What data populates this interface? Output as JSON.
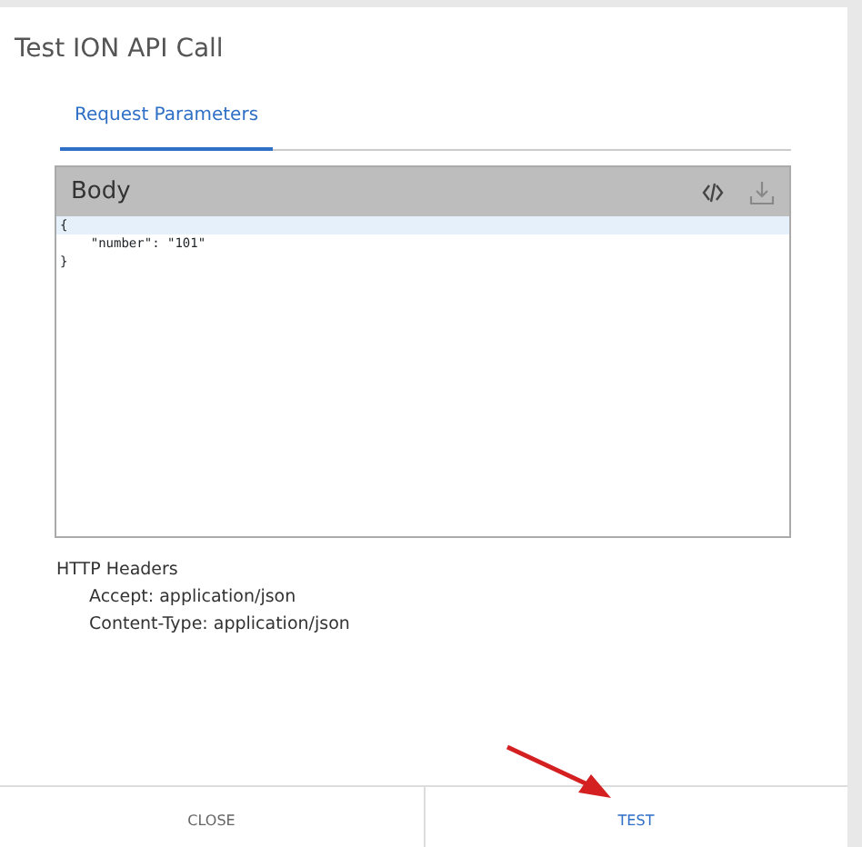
{
  "dialog": {
    "title": "Test ION API Call"
  },
  "tabs": [
    {
      "label": "Request Parameters",
      "selected": true
    }
  ],
  "body_panel": {
    "title": "Body",
    "lines": [
      {
        "text": "{",
        "highlighted": true
      },
      {
        "text": "    \"number\": \"101\"",
        "highlighted": false
      },
      {
        "text": "}",
        "highlighted": false
      }
    ]
  },
  "http_headers": {
    "title": "HTTP Headers",
    "lines": [
      "Accept: application/json",
      "Content-Type: application/json"
    ]
  },
  "buttons": [
    {
      "label": "CLOSE",
      "kind": "secondary"
    },
    {
      "label": "TEST",
      "kind": "primary"
    }
  ]
}
